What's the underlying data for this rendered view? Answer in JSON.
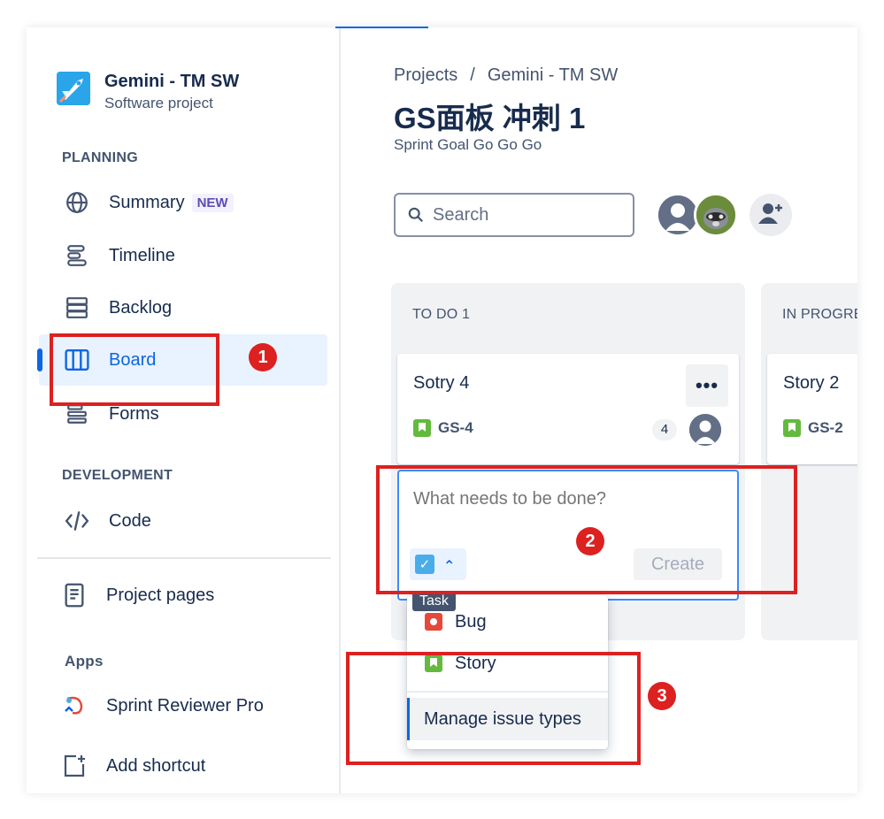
{
  "project": {
    "name": "Gemini - TM SW",
    "type": "Software project"
  },
  "sidebar": {
    "planning_heading": "PLANNING",
    "items": [
      {
        "label": "Summary",
        "badge": "NEW",
        "icon": "globe-icon"
      },
      {
        "label": "Timeline",
        "icon": "timeline-icon"
      },
      {
        "label": "Backlog",
        "icon": "backlog-icon"
      },
      {
        "label": "Board",
        "icon": "board-icon",
        "active": true
      },
      {
        "label": "Forms",
        "icon": "forms-icon"
      }
    ],
    "development_heading": "DEVELOPMENT",
    "dev_items": [
      {
        "label": "Code",
        "icon": "code-icon"
      }
    ],
    "project_pages": {
      "label": "Project pages",
      "icon": "page-icon"
    },
    "apps_heading": "Apps",
    "apps": [
      {
        "label": "Sprint Reviewer Pro",
        "icon": "app-icon"
      }
    ],
    "add_shortcut": {
      "label": "Add shortcut",
      "icon": "add-shortcut-icon"
    }
  },
  "header": {
    "breadcrumbs": [
      "Projects",
      "/",
      "Gemini - TM SW"
    ],
    "title": "GS面板 冲刺 1",
    "sprint_goal": "Sprint Goal Go Go Go",
    "search_placeholder": "Search"
  },
  "board": {
    "columns": [
      {
        "title": "TO DO 1"
      },
      {
        "title": "IN PROGRE"
      }
    ],
    "cards": [
      {
        "title": "Sotry 4",
        "key": "GS-4",
        "count": "4",
        "more": "•••"
      },
      {
        "title": "Story 2",
        "key": "GS-2"
      }
    ],
    "create": {
      "placeholder": "What needs to be done?",
      "button": "Create",
      "type_chevron": "⌃"
    },
    "type_tooltip": "Task",
    "dropdown": {
      "items": [
        {
          "label": "Bug"
        },
        {
          "label": "Story"
        }
      ],
      "manage": "Manage issue types"
    }
  },
  "annotations": [
    "1",
    "2",
    "3"
  ],
  "colors": {
    "accent": "#0c66e4",
    "annotation": "#dd2020",
    "story": "#63ba3c",
    "bug": "#e5493a",
    "task": "#4bade8"
  }
}
